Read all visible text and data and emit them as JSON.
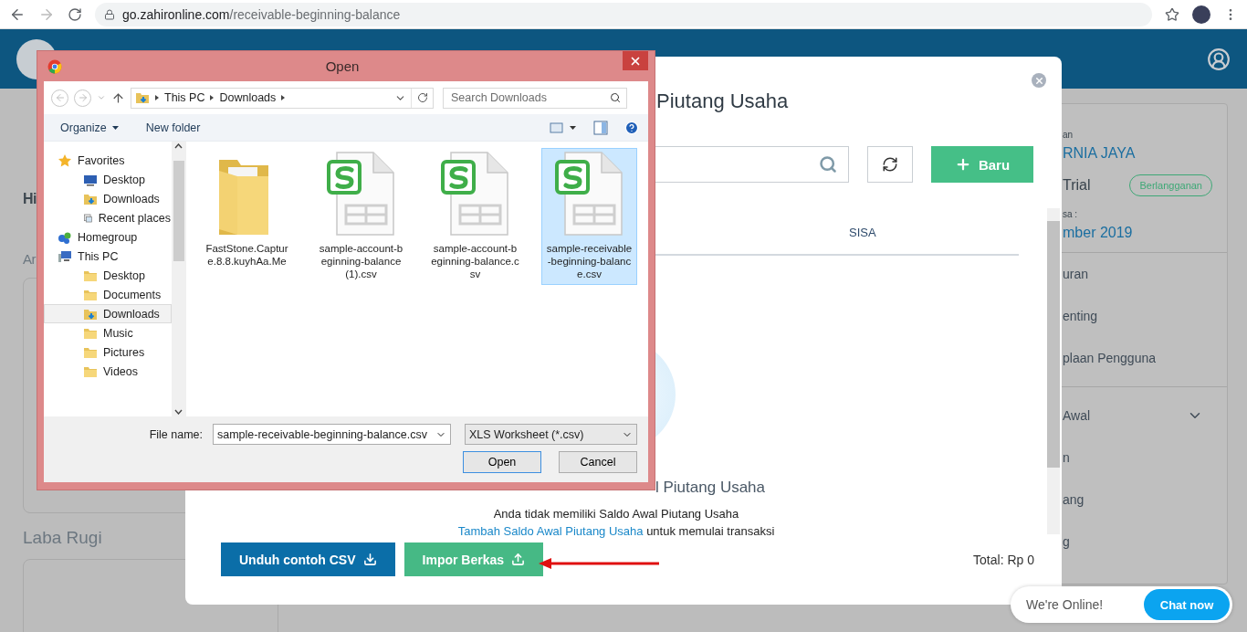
{
  "browser": {
    "url_host": "go.zahironline.com",
    "url_path": "/receivable-beginning-balance"
  },
  "background": {
    "greeting": "Hi",
    "section_1": "Ar",
    "section_2": "Laba Rugi",
    "side_panel": {
      "company_label": "an",
      "company": "RNIA JAYA",
      "plan": "Trial",
      "subscribe_button": "Berlangganan",
      "period_label": "sa :",
      "period": "mber 2019",
      "menu": [
        {
          "label": "uran",
          "kind": "link"
        },
        {
          "label": "enting",
          "kind": "link"
        },
        {
          "label": "plaan Pengguna",
          "kind": "link"
        },
        {
          "label": "Awal",
          "kind": "group"
        },
        {
          "label": "n",
          "kind": "link"
        },
        {
          "label": "ang",
          "kind": "link"
        },
        {
          "label": "g",
          "kind": "link"
        }
      ]
    }
  },
  "modal": {
    "title": "Piutang Usaha",
    "new_button": "Baru",
    "columns": [
      "SISA"
    ],
    "empty": {
      "title": "l Piutang Usaha",
      "message": "Anda tidak memiliki Saldo Awal Piutang Usaha",
      "link": "Tambah Saldo Awal Piutang Usaha",
      "link_suffix": " untuk memulai transaksi"
    },
    "download_button": "Unduh contoh CSV",
    "import_button": "Impor Berkas",
    "total": "Total: Rp 0"
  },
  "file_dialog": {
    "title": "Open",
    "path": [
      "This PC",
      "Downloads"
    ],
    "search_placeholder": "Search Downloads",
    "toolbar": [
      "Organize",
      "New folder"
    ],
    "nav": [
      {
        "label": "Favorites",
        "kind": "favorites",
        "selected": false,
        "children": [
          {
            "label": "Desktop",
            "kind": "desktop",
            "selected": false
          },
          {
            "label": "Downloads",
            "kind": "downloads",
            "selected": false
          },
          {
            "label": "Recent places",
            "kind": "recent",
            "selected": false
          }
        ]
      },
      {
        "label": "Homegroup",
        "kind": "homegroup",
        "selected": false
      },
      {
        "label": "This PC",
        "kind": "computer",
        "selected": false,
        "children": [
          {
            "label": "Desktop",
            "kind": "desktop-folder",
            "selected": false
          },
          {
            "label": "Documents",
            "kind": "folder",
            "selected": false
          },
          {
            "label": "Downloads",
            "kind": "downloads",
            "selected": true
          },
          {
            "label": "Music",
            "kind": "folder",
            "selected": false
          },
          {
            "label": "Pictures",
            "kind": "folder",
            "selected": false
          },
          {
            "label": "Videos",
            "kind": "folder",
            "selected": false
          }
        ]
      }
    ],
    "files": [
      {
        "name": "FastStone.Capture.8.8.kuyhAa.Me",
        "kind": "folder",
        "selected": false
      },
      {
        "name": "sample-account-beginning-balance (1).csv",
        "kind": "spreadsheet",
        "selected": false
      },
      {
        "name": "sample-account-beginning-balance.csv",
        "kind": "spreadsheet",
        "selected": false
      },
      {
        "name": "sample-receivable-beginning-balance.csv",
        "kind": "spreadsheet",
        "selected": true
      }
    ],
    "file_name_label": "File name:",
    "file_name": "sample-receivable-beginning-balance.csv",
    "file_type": "XLS Worksheet (*.csv)",
    "buttons": [
      "Open",
      "Cancel"
    ]
  },
  "chat": {
    "status": "We're Online!",
    "button": "Chat now"
  }
}
